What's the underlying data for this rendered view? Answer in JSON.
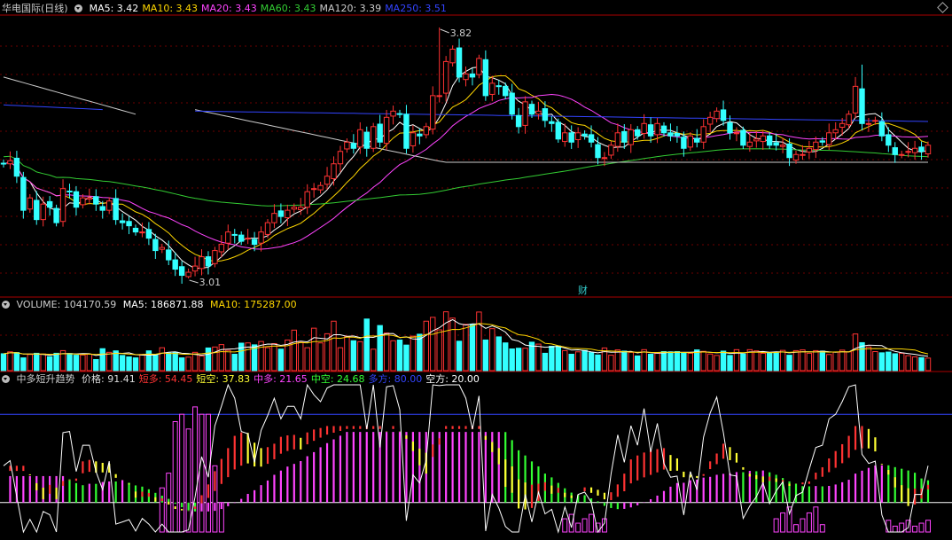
{
  "main": {
    "title": "华电国际(日线)",
    "ma": [
      {
        "label": "MA5: 3.42",
        "color": "#ffffff"
      },
      {
        "label": "MA10: 3.43",
        "color": "#ffd700"
      },
      {
        "label": "MA20: 3.43",
        "color": "#ff44ff"
      },
      {
        "label": "MA60: 3.43",
        "color": "#33cc33"
      },
      {
        "label": "MA120: 3.39",
        "color": "#cccccc"
      },
      {
        "label": "MA250: 3.51",
        "color": "#3344ff"
      }
    ],
    "high_label": "3.82",
    "low_label": "3.01",
    "event_marker": "财"
  },
  "volume": {
    "title": "VOLUME: 104170.59",
    "ma5": "MA5: 186871.88",
    "ma10": "MA10: 175287.00"
  },
  "indicator": {
    "title": "中多短升趋势",
    "items": [
      {
        "label": "价格: 91.41",
        "color": "#dddddd"
      },
      {
        "label": "短多: 54.45",
        "color": "#ff3333"
      },
      {
        "label": "短空: 37.83",
        "color": "#ffff33"
      },
      {
        "label": "中多: 21.65",
        "color": "#ff44ff"
      },
      {
        "label": "中空: 24.68",
        "color": "#33ff33"
      },
      {
        "label": "多方: 80.00",
        "color": "#3344ff"
      },
      {
        "label": "空方: 20.00",
        "color": "#ffffff"
      }
    ]
  },
  "colors": {
    "up": "#ff3333",
    "down": "#33ffff",
    "grid": "#6e0000",
    "sep": "#aa0000"
  },
  "chart_data": {
    "type": "candlestick",
    "ylim": [
      2.95,
      3.86
    ],
    "close": [
      3.38,
      3.39,
      3.34,
      3.23,
      3.27,
      3.2,
      3.25,
      3.24,
      3.19,
      3.3,
      3.29,
      3.24,
      3.27,
      3.27,
      3.25,
      3.23,
      3.26,
      3.2,
      3.19,
      3.18,
      3.16,
      3.16,
      3.14,
      3.1,
      3.11,
      3.07,
      3.04,
      3.02,
      3.03,
      3.05,
      3.08,
      3.05,
      3.1,
      3.12,
      3.16,
      3.15,
      3.13,
      3.14,
      3.12,
      3.16,
      3.19,
      3.22,
      3.21,
      3.23,
      3.24,
      3.24,
      3.29,
      3.3,
      3.31,
      3.34,
      3.38,
      3.42,
      3.45,
      3.43,
      3.49,
      3.43,
      3.5,
      3.45,
      3.53,
      3.55,
      3.54,
      3.43,
      3.48,
      3.47,
      3.5,
      3.6,
      3.6,
      3.71,
      3.75,
      3.66,
      3.67,
      3.66,
      3.72,
      3.6,
      3.64,
      3.63,
      3.6,
      3.54,
      3.5,
      3.58,
      3.54,
      3.55,
      3.52,
      3.51,
      3.46,
      3.48,
      3.45,
      3.48,
      3.47,
      3.45,
      3.4,
      3.4,
      3.44,
      3.48,
      3.45,
      3.49,
      3.47,
      3.51,
      3.47,
      3.51,
      3.48,
      3.47,
      3.47,
      3.43,
      3.47,
      3.45,
      3.5,
      3.53,
      3.55,
      3.52,
      3.48,
      3.48,
      3.44,
      3.45,
      3.46,
      3.47,
      3.44,
      3.44,
      3.44,
      3.4,
      3.41,
      3.41,
      3.43,
      3.45,
      3.45,
      3.48,
      3.49,
      3.51,
      3.54,
      3.63,
      3.51,
      3.51,
      3.52,
      3.47,
      3.44,
      3.41,
      3.41,
      3.42,
      3.43,
      3.42,
      3.44
    ],
    "volume": [
      70,
      78,
      75,
      53,
      67,
      72,
      69,
      58,
      72,
      83,
      71,
      64,
      65,
      68,
      46,
      91,
      76,
      82,
      63,
      57,
      53,
      67,
      82,
      64,
      95,
      73,
      76,
      53,
      56,
      76,
      61,
      94,
      98,
      108,
      84,
      68,
      114,
      115,
      107,
      121,
      95,
      112,
      89,
      127,
      168,
      117,
      95,
      176,
      115,
      153,
      205,
      95,
      142,
      124,
      120,
      214,
      89,
      187,
      156,
      124,
      127,
      106,
      143,
      151,
      205,
      221,
      169,
      244,
      218,
      122,
      192,
      192,
      243,
      127,
      174,
      140,
      115,
      90,
      93,
      93,
      118,
      110,
      72,
      101,
      102,
      83,
      68,
      78,
      84,
      75,
      65,
      94,
      64,
      86,
      81,
      76,
      61,
      87,
      68,
      72,
      79,
      78,
      79,
      73,
      72,
      86,
      80,
      69,
      63,
      81,
      63,
      87,
      69,
      87,
      82,
      72,
      72,
      77,
      84,
      64,
      83,
      86,
      72,
      83,
      81,
      67,
      77,
      85,
      78,
      152,
      116,
      98,
      79,
      74,
      77,
      70,
      72,
      62,
      57,
      54,
      52
    ],
    "indicator_ylim": [
      0,
      100
    ],
    "dual_lines": [
      80,
      20
    ],
    "y_range_note": "price axis 2.95 to 3.86"
  }
}
